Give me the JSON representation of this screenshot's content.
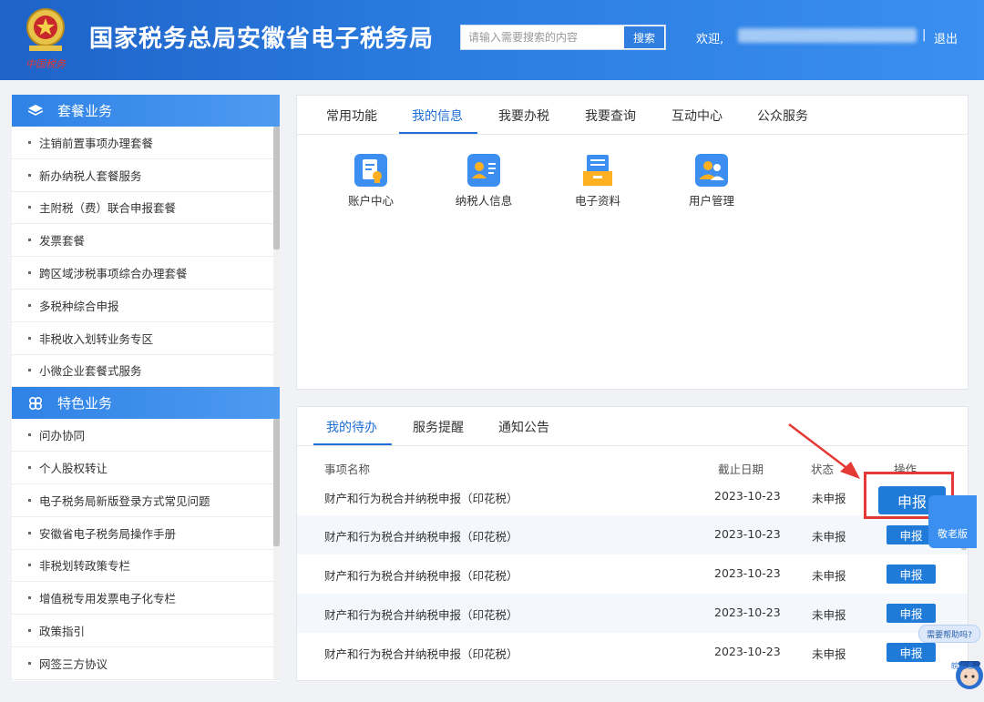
{
  "header": {
    "title": "国家税务总局安徽省电子税务局",
    "logo_text": "中国税务",
    "search_placeholder": "请输入需要搜索的内容",
    "search_button": "搜索",
    "welcome": "欢迎,",
    "separator": "|",
    "logout": "退出"
  },
  "sidebar": {
    "sections": [
      {
        "title": "套餐业务",
        "icon": "layers-icon",
        "items": [
          "注销前置事项办理套餐",
          "新办纳税人套餐服务",
          "主附税（费）联合申报套餐",
          "发票套餐",
          "跨区域涉税事项综合办理套餐",
          "多税种综合申报",
          "非税收入划转业务专区",
          "小微企业套餐式服务"
        ]
      },
      {
        "title": "特色业务",
        "icon": "clover-icon",
        "items": [
          "问办协同",
          "个人股权转让",
          "电子税务局新版登录方式常见问题",
          "安徽省电子税务局操作手册",
          "非税划转政策专栏",
          "增值税专用发票电子化专栏",
          "政策指引",
          "网签三方协议"
        ]
      }
    ]
  },
  "main_tabs": {
    "tabs": [
      "常用功能",
      "我的信息",
      "我要办税",
      "我要查询",
      "互动中心",
      "公众服务"
    ],
    "active_index": 1,
    "functions": [
      {
        "label": "账户中心",
        "icon": "account-document-icon"
      },
      {
        "label": "纳税人信息",
        "icon": "taxpayer-id-card-icon"
      },
      {
        "label": "电子资料",
        "icon": "electronic-files-icon"
      },
      {
        "label": "用户管理",
        "icon": "user-management-icon"
      }
    ]
  },
  "todo_panel": {
    "tabs": [
      "我的待办",
      "服务提醒",
      "通知公告"
    ],
    "active_index": 0,
    "columns": [
      "事项名称",
      "截止日期",
      "状态",
      "操作"
    ],
    "rows": [
      {
        "name": "财产和行为税合并纳税申报（印花税）",
        "date": "2023-10-23",
        "status": "未申报",
        "action": "申报"
      },
      {
        "name": "财产和行为税合并纳税申报（印花税）",
        "date": "2023-10-23",
        "status": "未申报",
        "action": "申报"
      },
      {
        "name": "财产和行为税合并纳税申报（印花税）",
        "date": "2023-10-23",
        "status": "未申报",
        "action": "申报"
      },
      {
        "name": "财产和行为税合并纳税申报（印花税）",
        "date": "2023-10-23",
        "status": "未申报",
        "action": "申报"
      },
      {
        "name": "财产和行为税合并纳税申报（印花税）",
        "date": "2023-10-23",
        "status": "未申报",
        "action": "申报"
      }
    ]
  },
  "widgets": {
    "elder_mode": "敬老版",
    "help_text": "需要帮助吗?",
    "robot_text": "皖税通"
  },
  "colors": {
    "header_blue": "#2b7ce0",
    "accent_blue": "#1f6fd6",
    "highlight_red": "#e53935"
  }
}
